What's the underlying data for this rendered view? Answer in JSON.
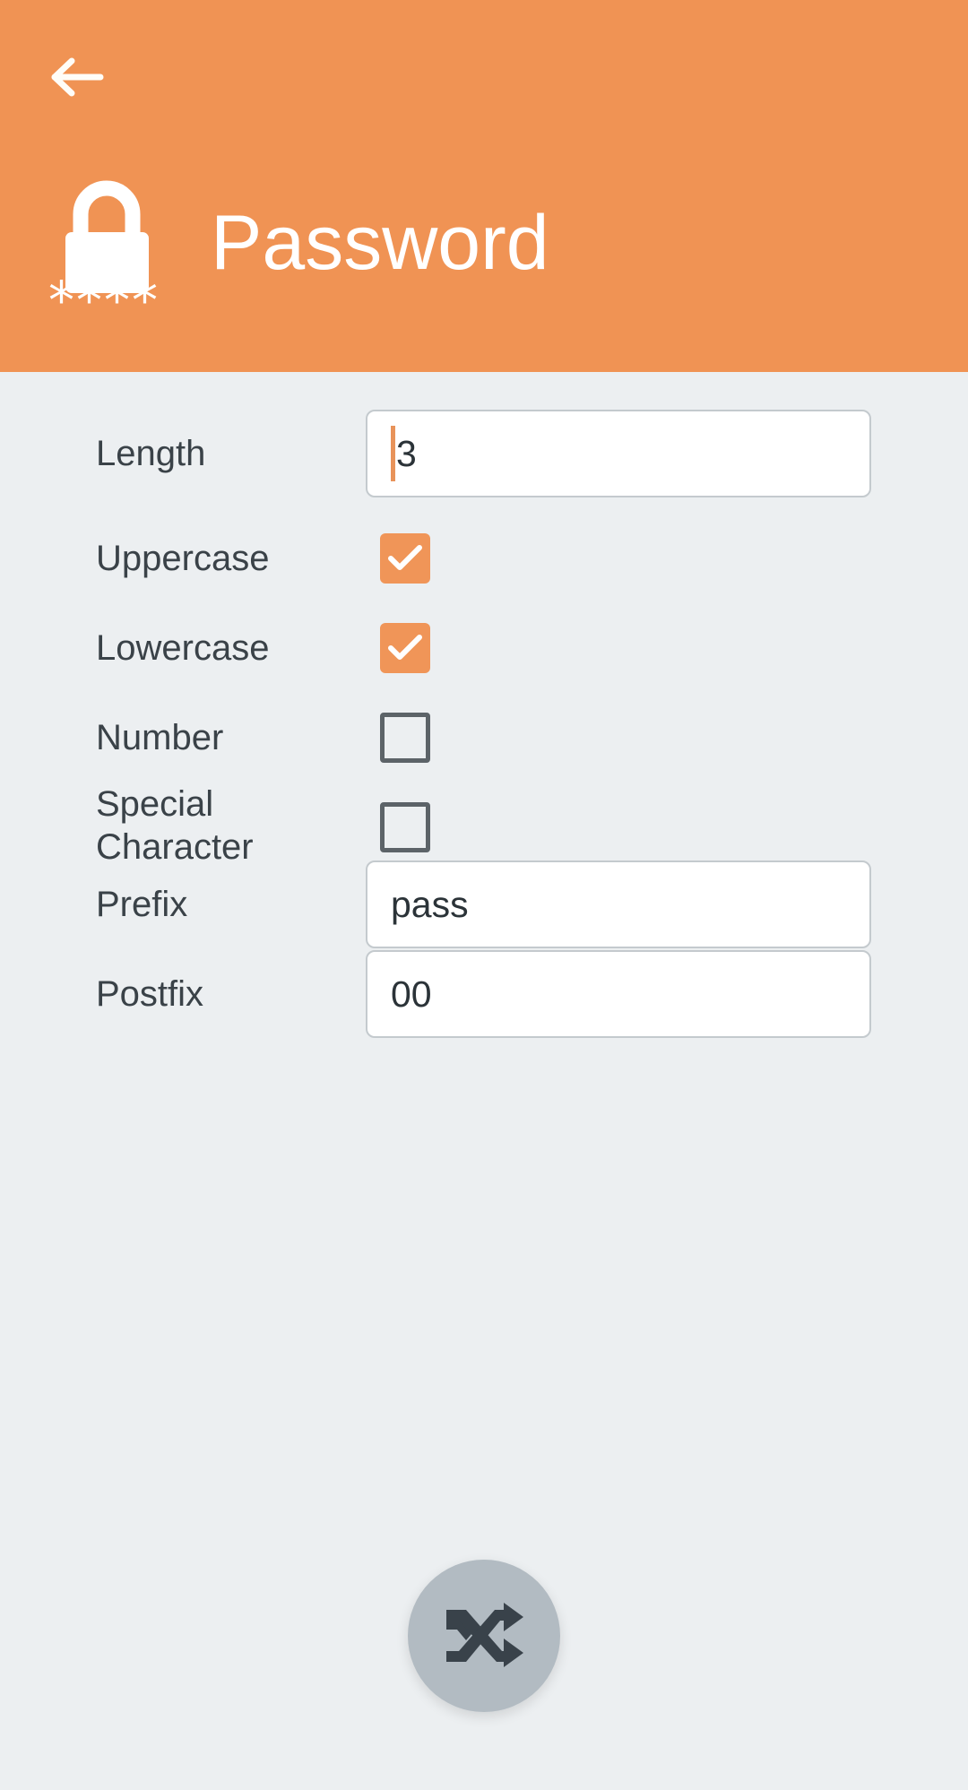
{
  "theme": {
    "header_bg": "#F09354",
    "page_bg": "#ECEFF1",
    "accent": "#F09558",
    "label_color": "#3A4248",
    "input_bg": "#FFFFFF",
    "input_border": "#C4CACE",
    "caret_color": "#E8935A",
    "fab_bg": "#B2BBC2",
    "fab_icon": "#39424A",
    "checkbox_unchecked_border": "#5C6368"
  },
  "header": {
    "title": "Password",
    "back_label": "Back",
    "back_icon": "arrow-left-icon",
    "app_icon": "padlock-asterisks-icon"
  },
  "form": {
    "rows": [
      {
        "label": "Length",
        "type": "text",
        "value": "3",
        "placeholder": "",
        "focused": true
      },
      {
        "label": "Uppercase",
        "type": "checkbox",
        "checked": true
      },
      {
        "label": "Lowercase",
        "type": "checkbox",
        "checked": true
      },
      {
        "label": "Number",
        "type": "checkbox",
        "checked": false
      },
      {
        "label": "Special Character",
        "type": "checkbox",
        "checked": false
      },
      {
        "label": "Prefix",
        "type": "text",
        "value": "pass",
        "placeholder": "",
        "focused": false
      },
      {
        "label": "Postfix",
        "type": "text",
        "value": "00",
        "placeholder": "",
        "focused": false
      }
    ]
  },
  "fab": {
    "label": "Generate",
    "icon": "shuffle-icon"
  }
}
